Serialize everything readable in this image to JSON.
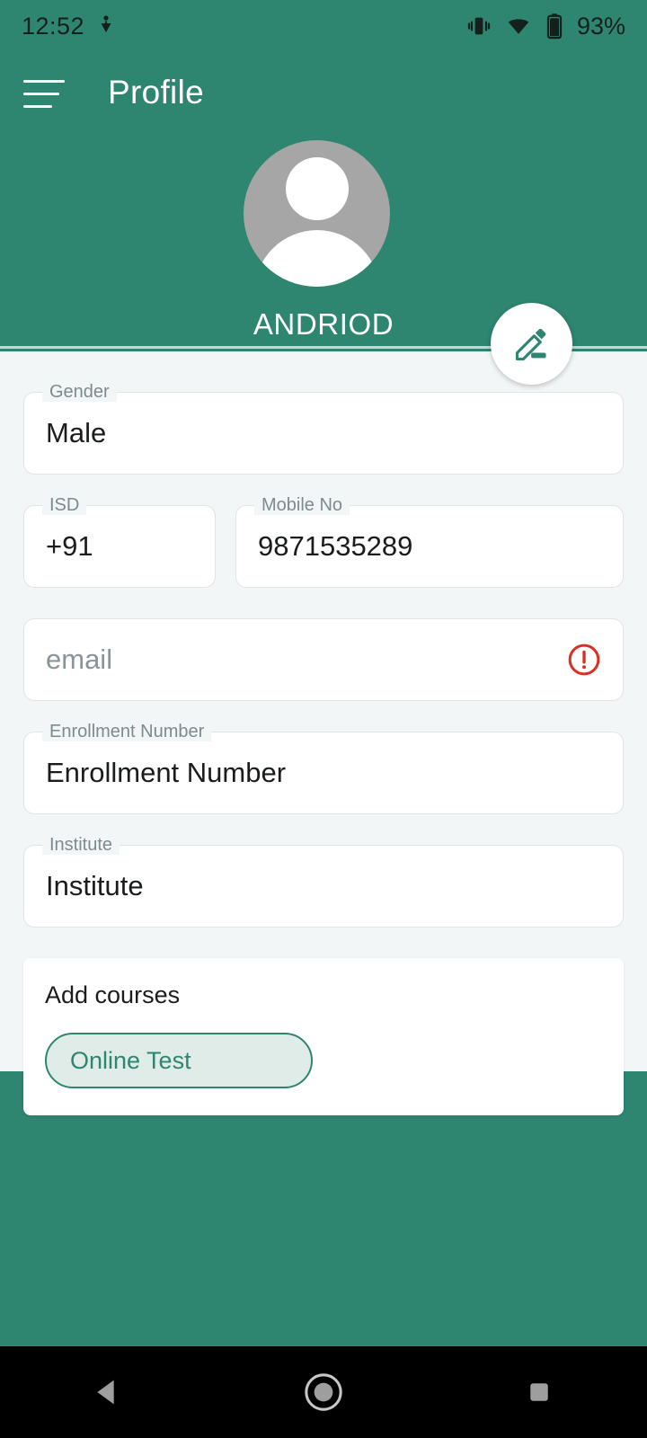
{
  "status_bar": {
    "time": "12:52",
    "download_icon": "download-arrow-icon",
    "vibrate_icon": "vibrate-icon",
    "wifi_icon": "wifi-icon",
    "battery_icon": "battery-icon",
    "battery_level": "93%"
  },
  "app_bar": {
    "menu_icon": "hamburger-menu-icon",
    "title": "Profile"
  },
  "profile": {
    "avatar_icon": "person-avatar-icon",
    "avatar_watermark": "",
    "name": "ANDRIOD",
    "edit_icon": "pencil-edit-icon"
  },
  "form": {
    "gender": {
      "label": "Gender",
      "value": "Male"
    },
    "isd": {
      "label": "ISD",
      "value": "+91"
    },
    "mobile": {
      "label": "Mobile No",
      "value": "9871535289"
    },
    "email": {
      "label": "",
      "placeholder": "email",
      "value": "",
      "error_icon": "error-exclamation-icon"
    },
    "enrollment": {
      "label": "Enrollment Number",
      "value": "Enrollment Number"
    },
    "institute": {
      "label": "Institute",
      "value": "Institute"
    }
  },
  "courses": {
    "title": "Add courses",
    "chips": [
      {
        "label": "Online Test"
      }
    ]
  },
  "nav_bar": {
    "back": "back-triangle-icon",
    "home": "home-circle-icon",
    "recents": "recents-square-icon"
  },
  "colors": {
    "brand_green": "#2E8570",
    "background": "#F2F6F7",
    "error_red": "#D93025",
    "chip_fill": "#DFECE7",
    "avatar_gray": "#A6A6A6"
  }
}
